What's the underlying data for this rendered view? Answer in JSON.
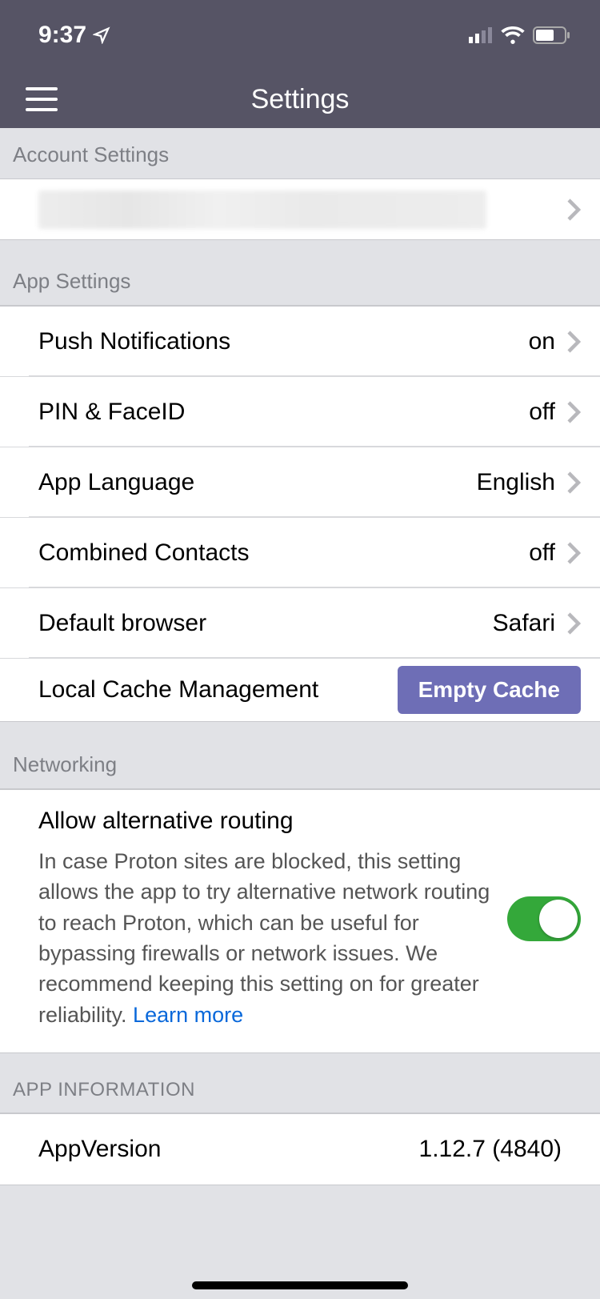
{
  "status": {
    "time": "9:37"
  },
  "nav": {
    "title": "Settings"
  },
  "sections": {
    "account": {
      "header": "Account Settings"
    },
    "app": {
      "header": "App Settings",
      "push": {
        "label": "Push Notifications",
        "value": "on"
      },
      "pin": {
        "label": "PIN & FaceID",
        "value": "off"
      },
      "lang": {
        "label": "App Language",
        "value": "English"
      },
      "contacts": {
        "label": "Combined Contacts",
        "value": "off"
      },
      "browser": {
        "label": "Default browser",
        "value": "Safari"
      },
      "cache": {
        "label": "Local Cache Management",
        "button": "Empty Cache"
      }
    },
    "networking": {
      "header": "Networking",
      "title": "Allow alternative routing",
      "desc": "In case Proton sites are blocked, this setting allows the app to try alternative network routing to reach Proton, which can be useful for bypassing firewalls or network issues. We recommend keeping this setting on for greater reliability. ",
      "learn_more": "Learn more",
      "toggle": true
    },
    "info": {
      "header": "APP INFORMATION",
      "version_label": "AppVersion",
      "version_value": "1.12.7 (4840)"
    }
  }
}
